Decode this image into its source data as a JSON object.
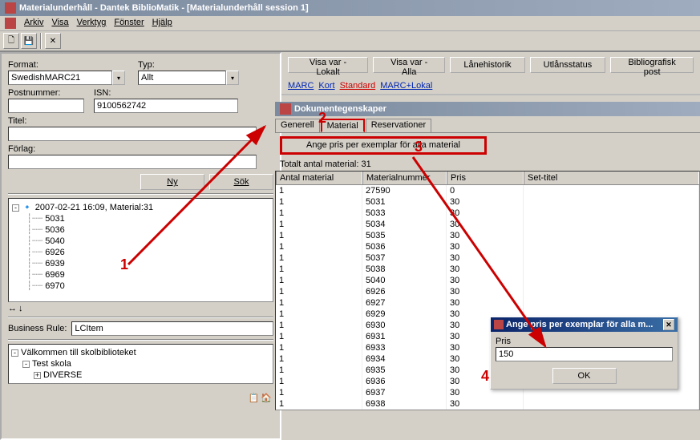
{
  "window": {
    "title": "Materialunderhåll - Dantek BiblioMatik - [Materialunderhåll session 1]"
  },
  "menu": {
    "arkiv": "Arkiv",
    "visa": "Visa",
    "verktyg": "Verktyg",
    "fonster": "Fönster",
    "hjalp": "Hjälp"
  },
  "left": {
    "format_label": "Format:",
    "format_value": "SwedishMARC21",
    "typ_label": "Typ:",
    "typ_value": "Allt",
    "postnummer_label": "Postnummer:",
    "postnummer_value": "",
    "isn_label": "ISN:",
    "isn_value": "9100562742",
    "titel_label": "Titel:",
    "titel_value": "",
    "forlag_label": "Förlag:",
    "ny": "Ny",
    "sok": "Sök",
    "business_rule_label": "Business Rule:",
    "business_rule_value": "LCItem"
  },
  "tree": {
    "root": "2007-02-21 16:09, Material:31",
    "items": [
      "5031",
      "5036",
      "5040",
      "6926",
      "6939",
      "6969",
      "6970"
    ]
  },
  "lowertree": {
    "root": "Välkommen till skolbiblioteket",
    "child1": "Test skola",
    "child2": "DIVERSE"
  },
  "topbuttons": {
    "b1": "Visa var - Lokalt",
    "b2": "Visa var - Alla",
    "b3": "Lånehistorik",
    "b4": "Utlånsstatus",
    "b5": "Bibliografisk post"
  },
  "linkbar": {
    "marc": "MARC",
    "kort": "Kort",
    "standard": "Standard",
    "marclokal": "MARC+Lokal"
  },
  "doc": {
    "title": "Dokumentegenskaper",
    "tab1": "Generell",
    "tab2": "Material",
    "tab3": "Reservationer",
    "widebtn": "Ange pris per exemplar för alla material",
    "total": "Totalt antal material: 31"
  },
  "grid": {
    "h1": "Antal material",
    "h2": "Materialnummer",
    "h3": "Pris",
    "h4": "Set-titel",
    "rows": [
      {
        "a": "1",
        "m": "27590",
        "p": "0"
      },
      {
        "a": "1",
        "m": "5031",
        "p": "30"
      },
      {
        "a": "1",
        "m": "5033",
        "p": "30"
      },
      {
        "a": "1",
        "m": "5034",
        "p": "30"
      },
      {
        "a": "1",
        "m": "5035",
        "p": "30"
      },
      {
        "a": "1",
        "m": "5036",
        "p": "30"
      },
      {
        "a": "1",
        "m": "5037",
        "p": "30"
      },
      {
        "a": "1",
        "m": "5038",
        "p": "30"
      },
      {
        "a": "1",
        "m": "5040",
        "p": "30"
      },
      {
        "a": "1",
        "m": "6926",
        "p": "30"
      },
      {
        "a": "1",
        "m": "6927",
        "p": "30"
      },
      {
        "a": "1",
        "m": "6929",
        "p": "30"
      },
      {
        "a": "1",
        "m": "6930",
        "p": "30"
      },
      {
        "a": "1",
        "m": "6931",
        "p": "30"
      },
      {
        "a": "1",
        "m": "6933",
        "p": "30"
      },
      {
        "a": "1",
        "m": "6934",
        "p": "30"
      },
      {
        "a": "1",
        "m": "6935",
        "p": "30"
      },
      {
        "a": "1",
        "m": "6936",
        "p": "30"
      },
      {
        "a": "1",
        "m": "6937",
        "p": "30"
      },
      {
        "a": "1",
        "m": "6938",
        "p": "30"
      }
    ]
  },
  "dialog": {
    "title": "Ange pris per exemplar för alla m...",
    "pris_label": "Pris",
    "pris_value": "150",
    "ok": "OK"
  },
  "annotations": {
    "n1": "1",
    "n2": "2",
    "n3": "3",
    "n4": "4"
  }
}
